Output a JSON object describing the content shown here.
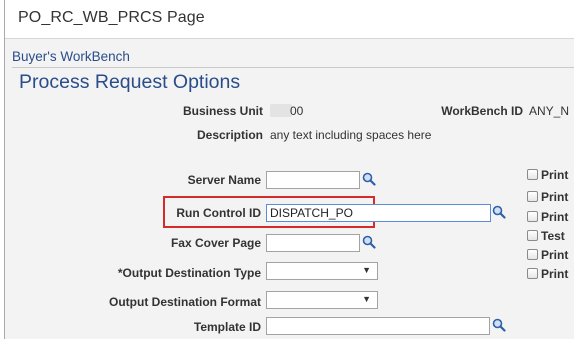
{
  "page_title": "PO_RC_WB_PRCS Page",
  "component": "Buyer's WorkBench",
  "section_title": "Process Request Options",
  "fields": {
    "business_unit_label": "Business Unit",
    "business_unit_value": "00",
    "workbench_id_label": "WorkBench ID",
    "workbench_id_value": "ANY_N",
    "description_label": "Description",
    "description_value": "any text including spaces here",
    "server_name_label": "Server Name",
    "server_name_value": "",
    "run_control_label": "Run Control ID",
    "run_control_value": "DISPATCH_PO",
    "fax_cover_label": "Fax Cover Page",
    "fax_cover_value": "",
    "output_type_label": "*Output Destination Type",
    "output_type_value": "",
    "output_format_label": "Output Destination Format",
    "output_format_value": "",
    "template_label": "Template ID",
    "template_value": ""
  },
  "checkboxes": [
    {
      "label": "Print"
    },
    {
      "label": "Print"
    },
    {
      "label": "Print"
    },
    {
      "label": "Test"
    },
    {
      "label": "Print"
    },
    {
      "label": "Print"
    }
  ],
  "icons": {
    "lookup": "magnifier-icon",
    "dropdown": "chevron-down-icon"
  },
  "colors": {
    "accent": "#2a4d8a",
    "highlight": "#d52b2b",
    "background": "#f3f3f3"
  }
}
